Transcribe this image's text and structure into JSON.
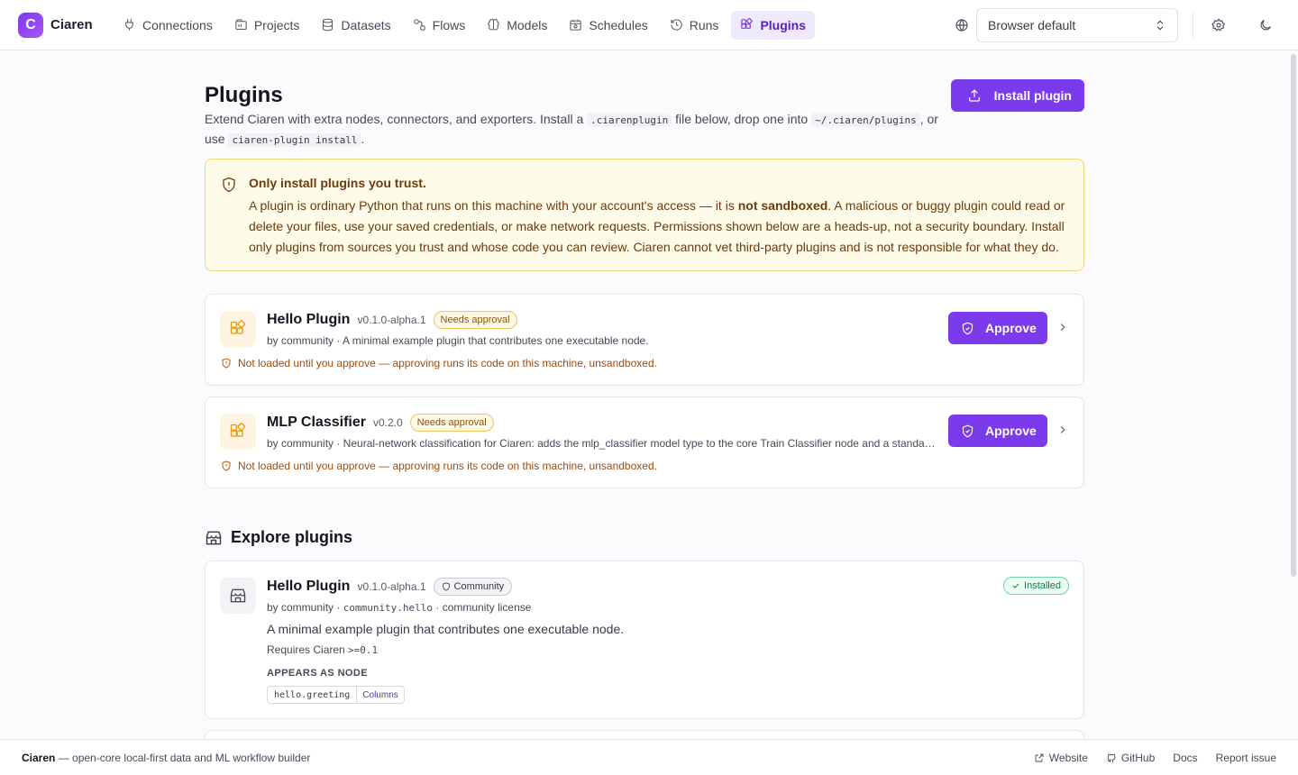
{
  "brand": {
    "logo": "C",
    "name": "Ciaren"
  },
  "nav": [
    {
      "label": "Connections",
      "icon": "plug-icon"
    },
    {
      "label": "Projects",
      "icon": "folder-icon"
    },
    {
      "label": "Datasets",
      "icon": "database-icon"
    },
    {
      "label": "Flows",
      "icon": "workflow-icon"
    },
    {
      "label": "Models",
      "icon": "brain-icon"
    },
    {
      "label": "Schedules",
      "icon": "calendar-icon"
    },
    {
      "label": "Runs",
      "icon": "history-icon"
    },
    {
      "label": "Plugins",
      "icon": "puzzle-icon",
      "active": true
    }
  ],
  "topbar": {
    "language_value": "Browser default"
  },
  "page": {
    "title": "Plugins",
    "desc_1": "Extend Ciaren with extra nodes, connectors, and exporters. Install a",
    "code_1": ".ciarenplugin",
    "desc_2": "file below, drop one into",
    "code_2": "~/.ciaren/plugins",
    "desc_3": ", or use",
    "code_3": "ciaren-plugin install",
    "desc_4": ".",
    "install_label": "Install plugin"
  },
  "warning": {
    "title": "Only install plugins you trust.",
    "text_1": "A plugin is ordinary Python that runs on this machine with your account's access — it is",
    "bold": "not sandboxed",
    "text_2": ". A malicious or buggy plugin could read or delete your files, use your saved credentials, or make network requests. Permissions shown below are a heads-up, not a security boundary. Install only plugins from sources you trust and whose code you can review. Ciaren cannot vet third-party plugins and is not responsible for what they do."
  },
  "pending": [
    {
      "name": "Hello Plugin",
      "version": "v0.1.0-alpha.1",
      "badge": "Needs approval",
      "meta": "by community · A minimal example plugin that contributes one executable node.",
      "note": "Not loaded until you approve — approving runs its code on this machine, unsandboxed.",
      "action": "Approve"
    },
    {
      "name": "MLP Classifier",
      "version": "v0.2.0",
      "badge": "Needs approval",
      "meta": "by community · Neural-network classification for Ciaren: adds the mlp_classifier model type to the core Train Classifier node and a standalone MLP node",
      "note": "Not loaded until you approve — approving runs its code on this machine, unsandboxed.",
      "action": "Approve"
    }
  ],
  "explore": {
    "title": "Explore plugins",
    "items": [
      {
        "name": "Hello Plugin",
        "version": "v0.1.0-alpha.1",
        "badge": "Community",
        "status": "Installed",
        "by": "by community ·",
        "id": "community.hello",
        "license": "· community license",
        "description": "A minimal example plugin that contributes one executable node.",
        "requires_label": "Requires Ciaren",
        "requires_value": ">=0.1",
        "appears_label": "APPEARS AS NODE",
        "node_id": "hello.greeting",
        "node_category": "Columns"
      }
    ]
  },
  "footer": {
    "name": "Ciaren",
    "tagline": "— open-core local-first data and ML workflow builder",
    "links": [
      "Website",
      "GitHub",
      "Docs",
      "Report issue"
    ]
  }
}
